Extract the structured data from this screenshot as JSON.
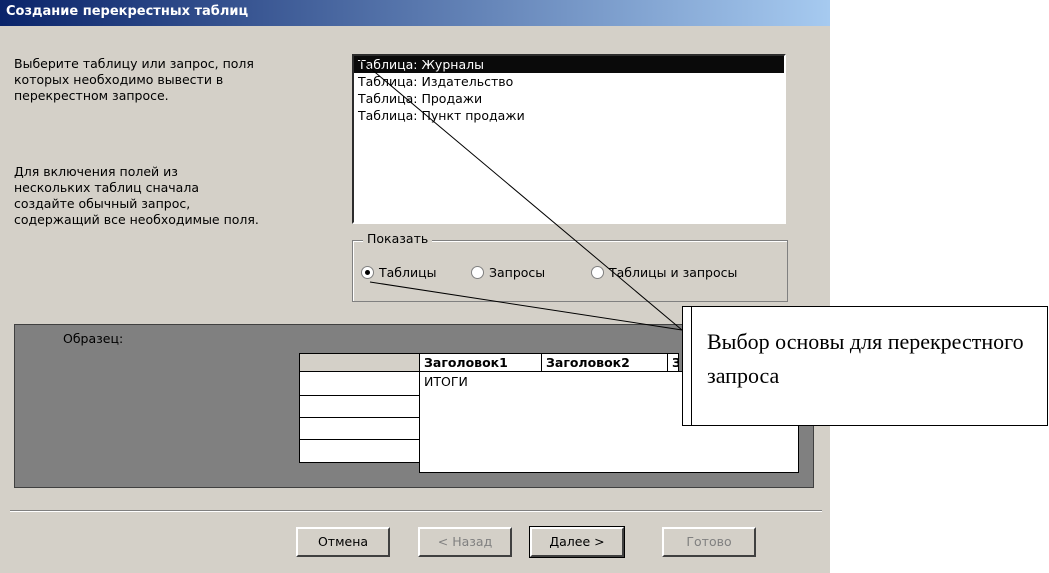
{
  "window": {
    "title": "Создание перекрестных таблиц"
  },
  "instructions": {
    "text1": "Выберите таблицу или запрос, поля\nкоторых необходимо вывести в\nперекрестном запросе.",
    "text2": "Для включения полей из\nнескольких таблиц сначала\nсоздайте обычный запрос,\nсодержащий все необходимые поля."
  },
  "list": {
    "items": [
      "Таблица: Журналы",
      "Таблица: Издательство",
      "Таблица: Продажи",
      "Таблица: Пункт продажи"
    ],
    "selected_index": 0
  },
  "show_group": {
    "legend": "Показать",
    "options": [
      "Таблицы",
      "Запросы",
      "Таблицы и запросы"
    ],
    "selected": "Таблицы"
  },
  "sample": {
    "label": "Образец:",
    "headers": [
      "Заголовок1",
      "Заголовок2",
      "З"
    ],
    "totals_label": "ИТОГИ"
  },
  "buttons": {
    "cancel": "Отмена",
    "back": "< Назад",
    "next": "Далее >",
    "finish": "Готово"
  },
  "annotation": {
    "text": "Выбор основы для перекрестного запроса"
  },
  "colors": {
    "selection": "#0a0a0a",
    "titlebar": "#0a246a",
    "dialog": "#d4d0c8",
    "sample_bg": "#808080"
  }
}
